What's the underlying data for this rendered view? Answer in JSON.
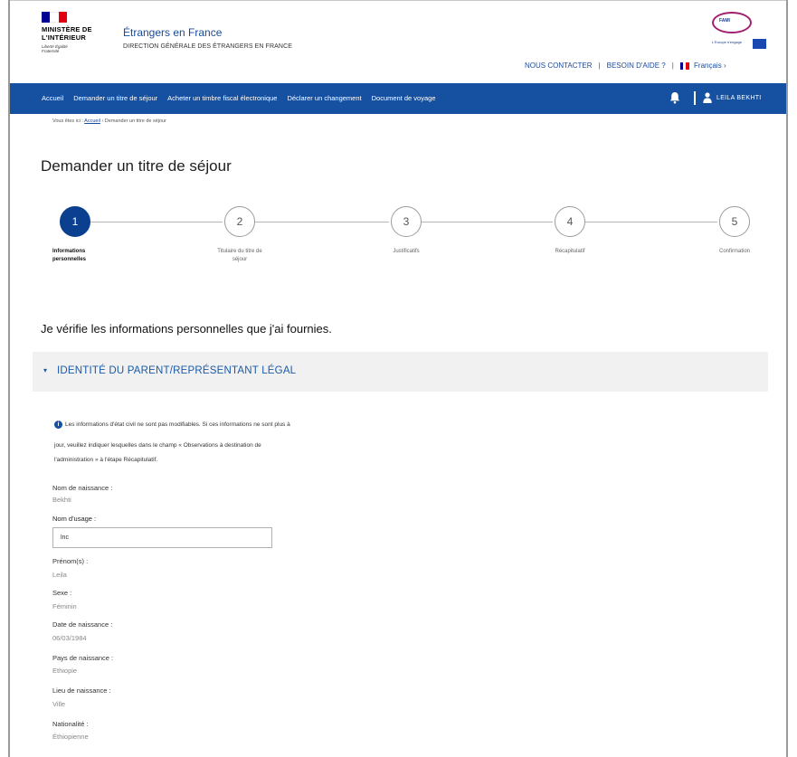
{
  "header": {
    "ministry": "MINISTÈRE DE L'INTÉRIEUR",
    "motto": "Liberté Égalité Fraternité",
    "site_title": "Étrangers en France",
    "site_subtitle": "DIRECTION GÉNÉRALE DES ÉTRANGERS EN FRANCE",
    "eu_logo_text": "FAMI",
    "eu_caption": "L'Europe s'engage",
    "links": {
      "contact": "NOUS CONTACTER",
      "help": "BESOIN D'AIDE ?",
      "language": "Français"
    }
  },
  "nav": {
    "items": [
      "Accueil",
      "Demander un titre de séjour",
      "Acheter un timbre fiscal électronique",
      "Déclarer un changement",
      "Document de voyage"
    ],
    "user_name": "LEILA BEKHTI"
  },
  "breadcrumb": {
    "prefix": "Vous êtes ici :",
    "home": "Accueil",
    "current": "› Demander un titre de séjour"
  },
  "page_title": "Demander un titre de séjour",
  "stepper": {
    "current": 1,
    "steps": [
      {
        "number": "1",
        "label_line1": "Informations",
        "label_line2": "personnelles"
      },
      {
        "number": "2",
        "label_line1": "Titulaire du titre de",
        "label_line2": "séjour"
      },
      {
        "number": "3",
        "label_line1": "Justificatifs",
        "label_line2": ""
      },
      {
        "number": "4",
        "label_line1": "Récapitulatif",
        "label_line2": ""
      },
      {
        "number": "5",
        "label_line1": "Confirmation",
        "label_line2": ""
      }
    ]
  },
  "verify_title": "Je vérifie les informations personnelles que j'ai fournies.",
  "section": {
    "title": "IDENTITÉ DU PARENT/REPRÉSENTANT LÉGAL"
  },
  "info": {
    "line1": "Les informations d'état civil ne sont pas modifiables. Si ces informations ne sont plus à",
    "line2": "jour, veuillez indiquer lesquelles dans le champ « Observations à destination de",
    "line3": "l'administration » à l'étape Récapitulatif."
  },
  "fields": {
    "birth_name_label": "Nom de naissance :",
    "birth_name_value": "Bekhti",
    "usage_name_label": "Nom d'usage :",
    "usage_name_value": "lnc",
    "firstnames_label": "Prénom(s) :",
    "firstnames_value": "Leila",
    "sex_label": "Sexe :",
    "sex_value": "Féminin",
    "birthdate_label": "Date de naissance :",
    "birthdate_value": "06/03/1984",
    "birth_country_label": "Pays de naissance :",
    "birth_country_value": "Ethiopie",
    "birth_place_label": "Lieu de naissance :",
    "birth_place_value": "Ville",
    "nationality_label": "Nationalité :",
    "nationality_value": "Éthiopienne"
  },
  "colors": {
    "nav_bg": "#1650a0",
    "accent": "#1a5aa8",
    "active_step": "#0b3f8f"
  }
}
